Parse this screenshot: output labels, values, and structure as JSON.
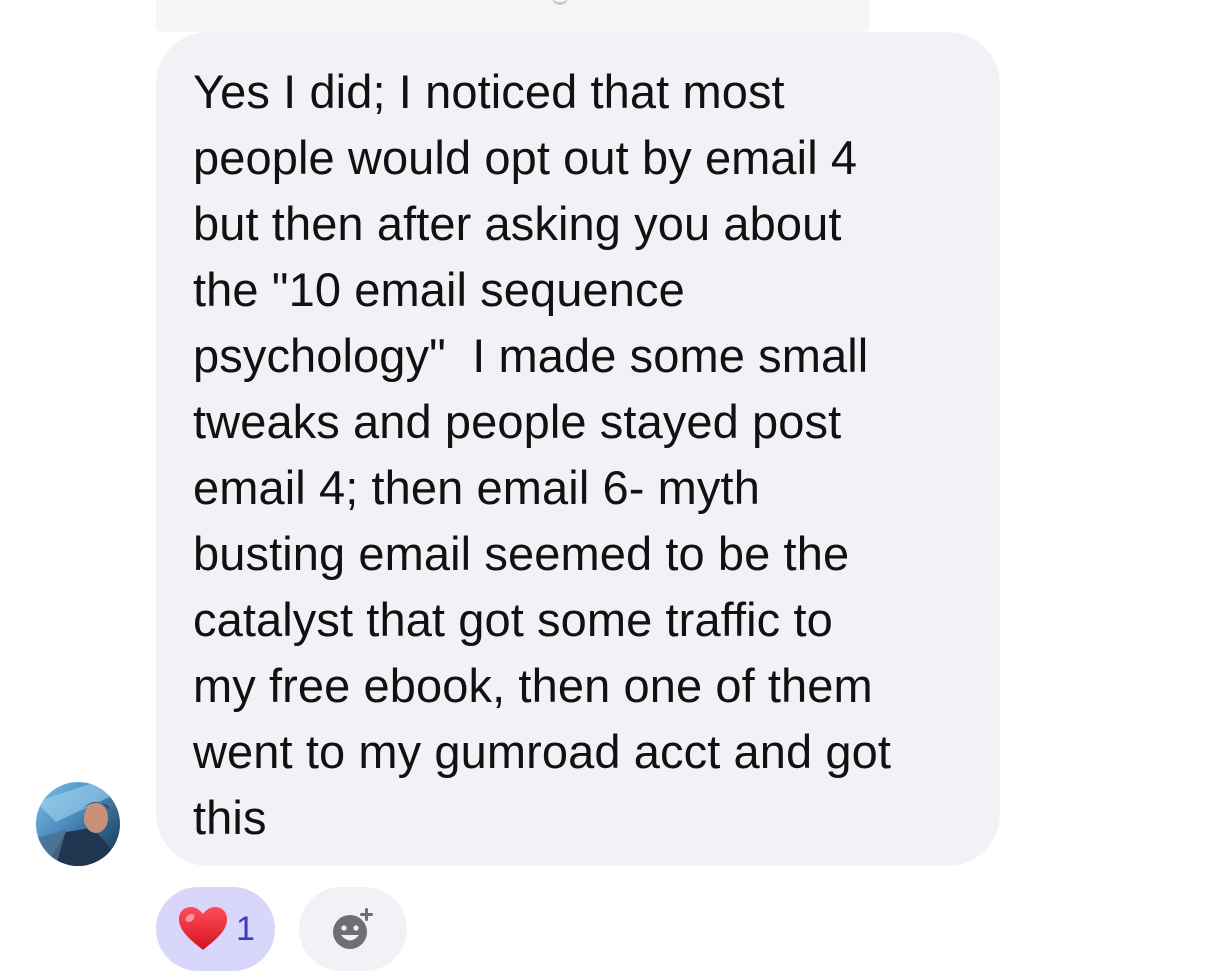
{
  "message": {
    "text": "Yes I did; I noticed that most\npeople would opt out by email 4\nbut then after asking you about\nthe \"10 email sequence\npsychology\"  I made some small\ntweaks and people stayed post\nemail 4; then email 6- myth\nbusting email seemed to be the\ncatalyst that got some traffic to\nmy free ebook, then one of them\nwent to my gumroad acct and got\nthis"
  },
  "reactions": [
    {
      "icon": "heart-icon",
      "count": "1"
    }
  ],
  "add_reaction": {
    "icon": "add-emoji-icon"
  },
  "colors": {
    "bubble": "#f1f2f6",
    "reaction_active": "#d9d6fb",
    "reaction_count": "#3a3ac8",
    "heart": "#e0202e"
  }
}
